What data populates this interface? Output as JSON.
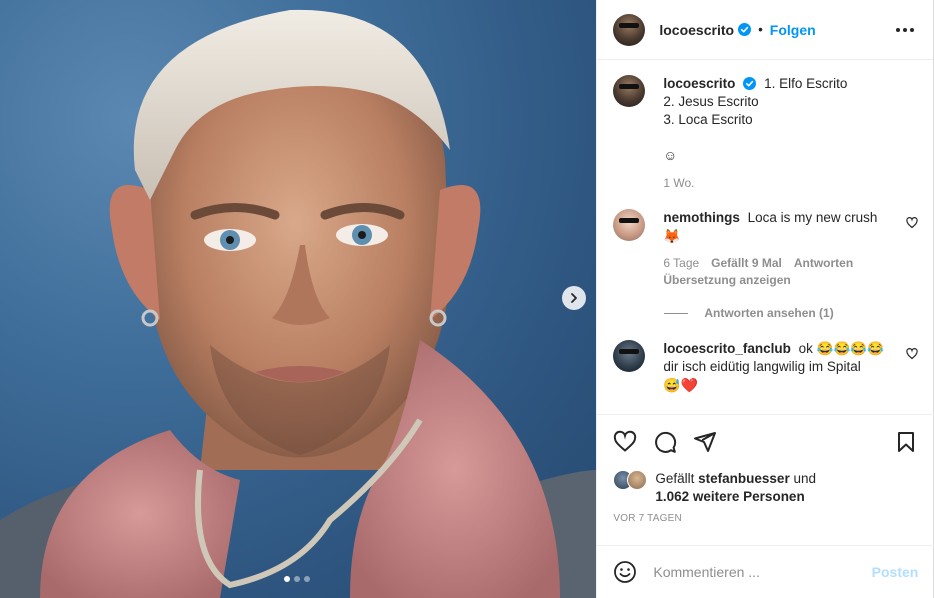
{
  "post": {
    "media": {
      "alt": "",
      "carousel_dots": 3,
      "active_dot": 0
    },
    "header": {
      "username": "locoescrito",
      "separator": "•",
      "follow_label": "Folgen"
    },
    "caption": {
      "username": "locoescrito",
      "lines": [
        "1. Elfo Escrito",
        "2. Jesus Escrito",
        "3. Loca Escrito",
        "",
        "☺"
      ],
      "time": "1 Wo."
    },
    "comments": [
      {
        "username": "nemothings",
        "text": "Loca is my new crush",
        "emoji": "🦊",
        "time": "6 Tage",
        "likes": "Gefällt 9 Mal",
        "reply_label": "Antworten",
        "translate_label": "Übersetzung anzeigen",
        "view_replies": "Antworten ansehen (1)"
      },
      {
        "username": "locoescrito_fanclub",
        "text": "ok 😂😂😂😂",
        "text2": "dir isch eidütig langwilig im Spital",
        "emoji": "😅❤️"
      }
    ],
    "likes": {
      "prefix": "Gefällt",
      "user": "stefanbuesser",
      "connector": "und",
      "others": "1.062 weitere Personen"
    },
    "timestamp": "VOR 7 TAGEN",
    "composer": {
      "placeholder": "Kommentieren ...",
      "post_label": "Posten"
    },
    "colors": {
      "accent": "#0095f6",
      "post_disabled": "#b2dffc",
      "muted": "#8e8e8e"
    }
  }
}
